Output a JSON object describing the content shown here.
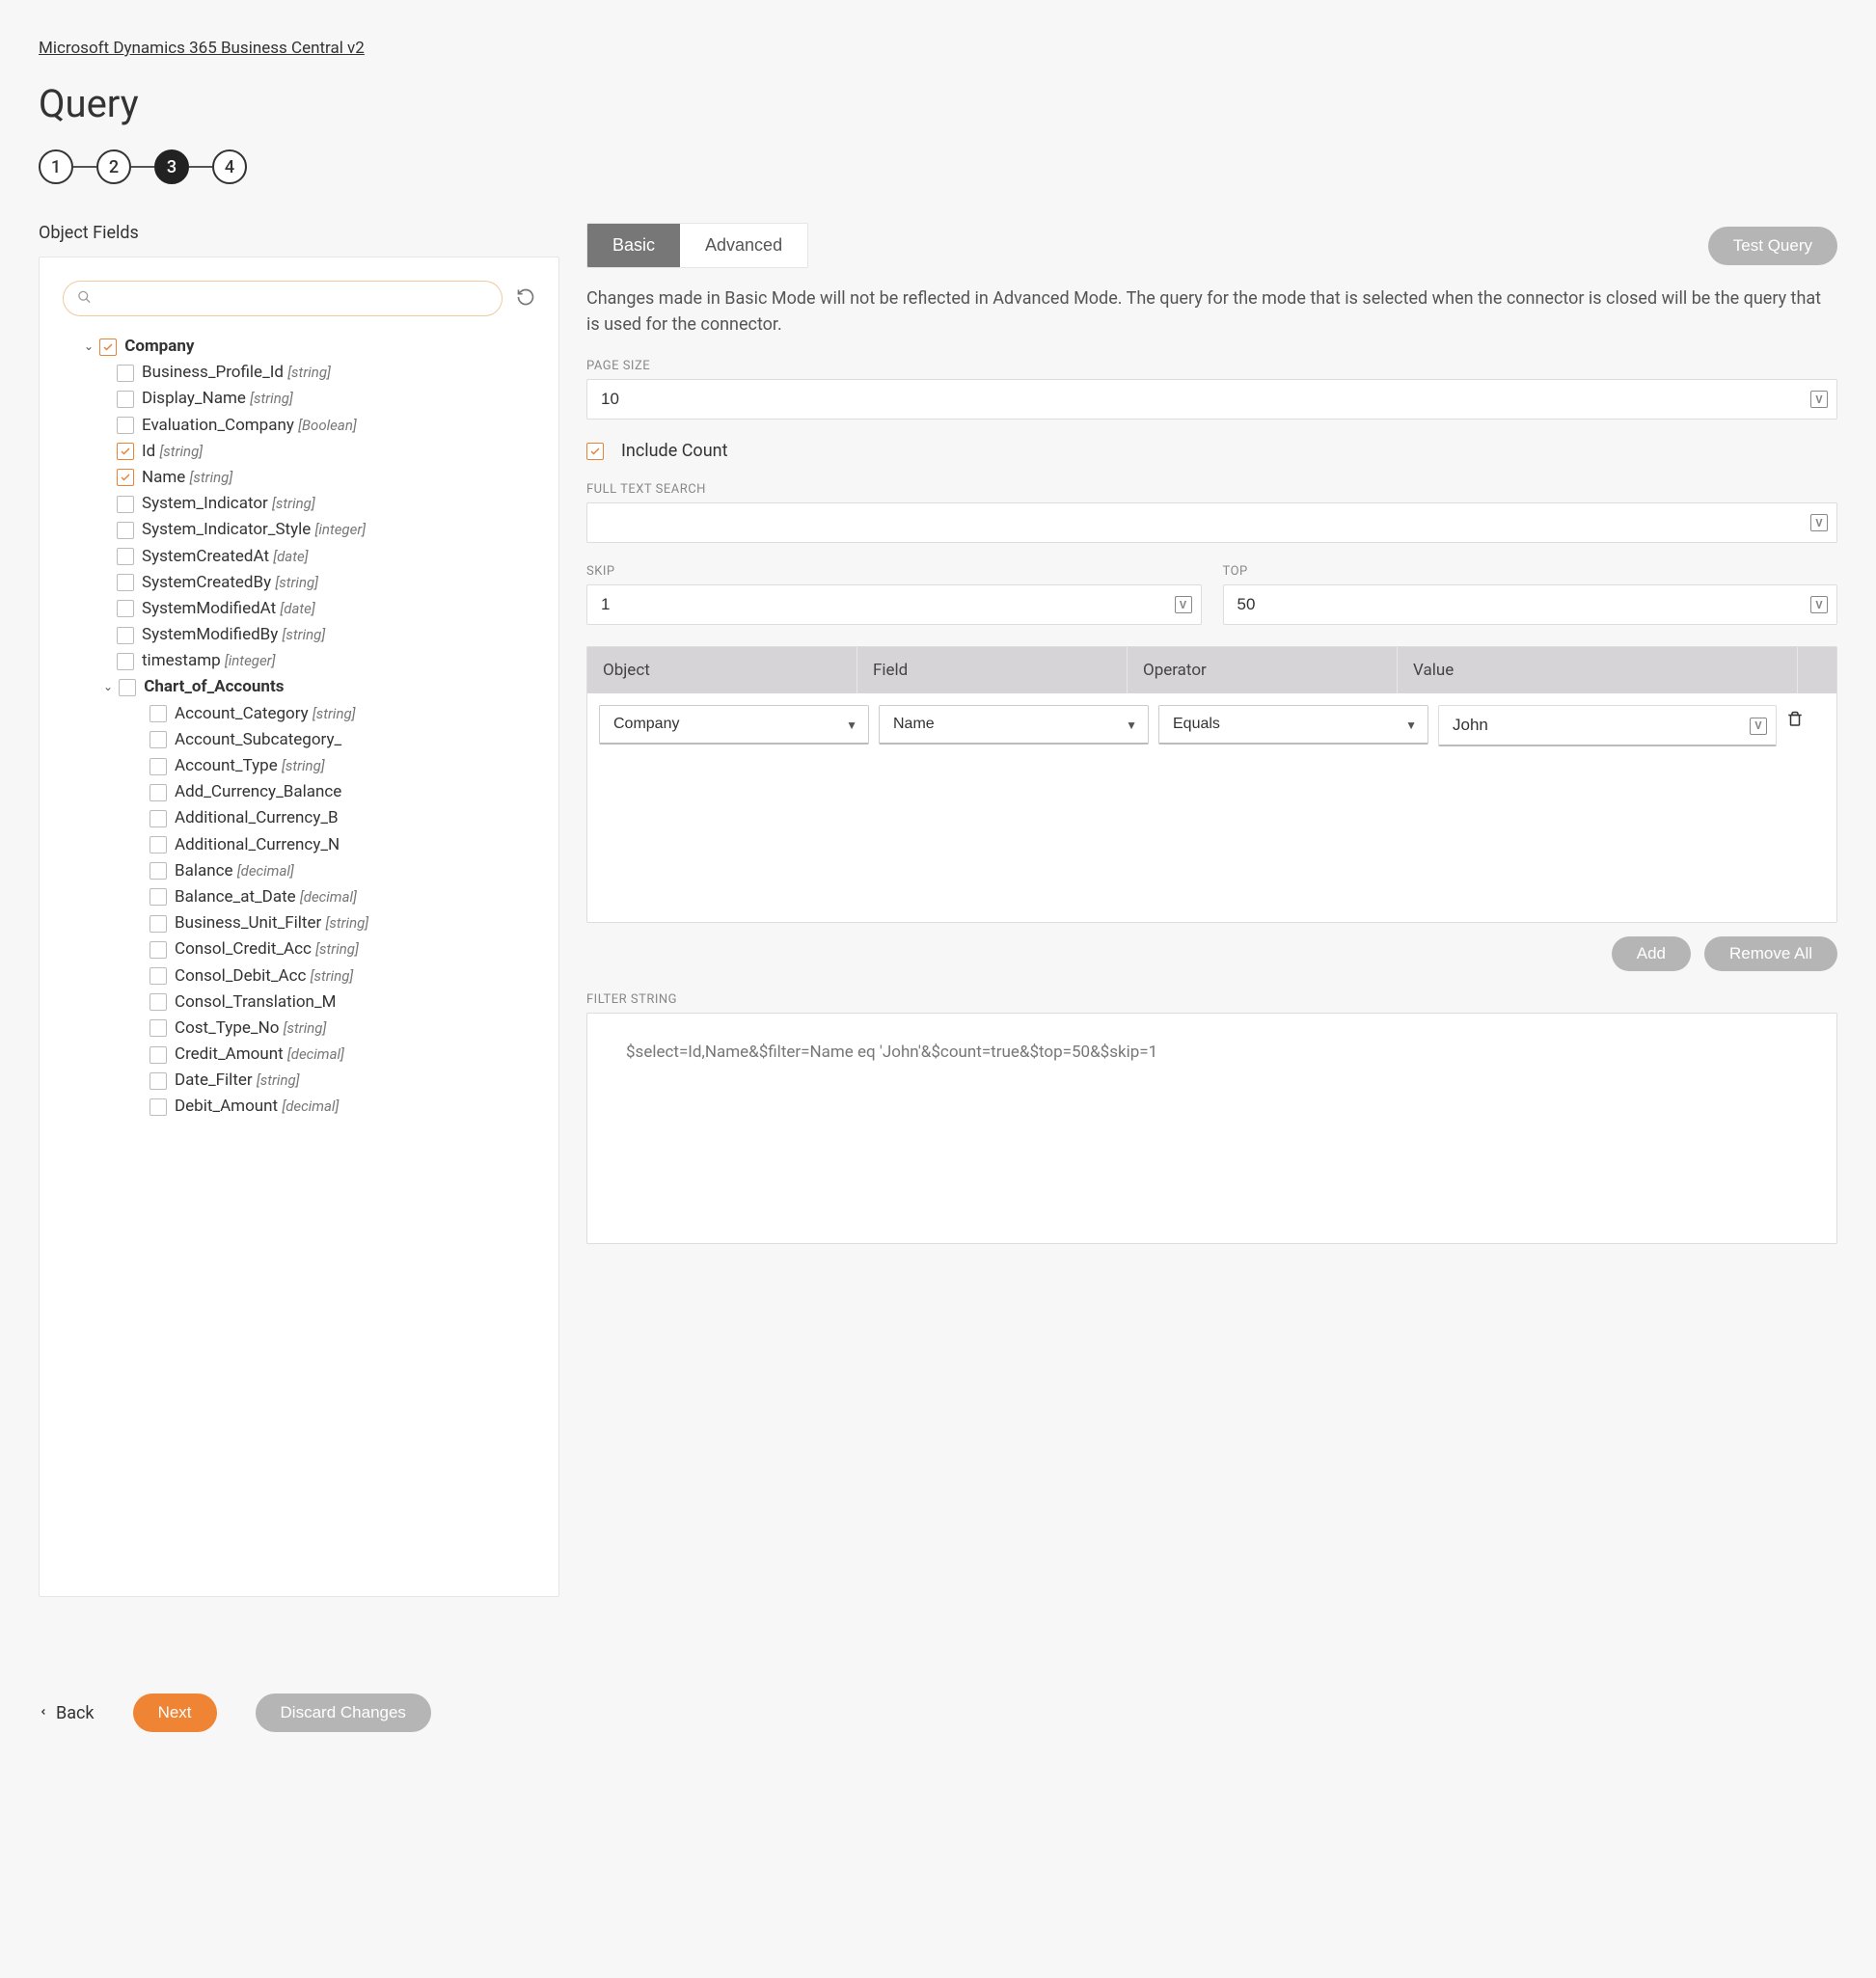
{
  "breadcrumb": "Microsoft Dynamics 365 Business Central v2",
  "page_title": "Query",
  "stepper": {
    "steps": [
      "1",
      "2",
      "3",
      "4"
    ],
    "active": 2
  },
  "left": {
    "title": "Object Fields",
    "search_placeholder": "",
    "tree": {
      "root": {
        "label": "Company",
        "checked": true
      },
      "company_fields": [
        {
          "label": "Business_Profile_Id",
          "type": "[string]",
          "checked": false
        },
        {
          "label": "Display_Name",
          "type": "[string]",
          "checked": false
        },
        {
          "label": "Evaluation_Company",
          "type": "[Boolean]",
          "checked": false
        },
        {
          "label": "Id",
          "type": "[string]",
          "checked": true
        },
        {
          "label": "Name",
          "type": "[string]",
          "checked": true
        },
        {
          "label": "System_Indicator",
          "type": "[string]",
          "checked": false
        },
        {
          "label": "System_Indicator_Style",
          "type": "[integer]",
          "checked": false
        },
        {
          "label": "SystemCreatedAt",
          "type": "[date]",
          "checked": false
        },
        {
          "label": "SystemCreatedBy",
          "type": "[string]",
          "checked": false
        },
        {
          "label": "SystemModifiedAt",
          "type": "[date]",
          "checked": false
        },
        {
          "label": "SystemModifiedBy",
          "type": "[string]",
          "checked": false
        },
        {
          "label": "timestamp",
          "type": "[integer]",
          "checked": false
        }
      ],
      "child": {
        "label": "Chart_of_Accounts",
        "checked": false
      },
      "child_fields": [
        {
          "label": "Account_Category",
          "type": "[string]",
          "checked": false
        },
        {
          "label": "Account_Subcategory_",
          "type": "",
          "checked": false
        },
        {
          "label": "Account_Type",
          "type": "[string]",
          "checked": false
        },
        {
          "label": "Add_Currency_Balance",
          "type": "",
          "checked": false
        },
        {
          "label": "Additional_Currency_B",
          "type": "",
          "checked": false
        },
        {
          "label": "Additional_Currency_N",
          "type": "",
          "checked": false
        },
        {
          "label": "Balance",
          "type": "[decimal]",
          "checked": false
        },
        {
          "label": "Balance_at_Date",
          "type": "[decimal]",
          "checked": false
        },
        {
          "label": "Business_Unit_Filter",
          "type": "[string]",
          "checked": false
        },
        {
          "label": "Consol_Credit_Acc",
          "type": "[string]",
          "checked": false
        },
        {
          "label": "Consol_Debit_Acc",
          "type": "[string]",
          "checked": false
        },
        {
          "label": "Consol_Translation_M",
          "type": "",
          "checked": false
        },
        {
          "label": "Cost_Type_No",
          "type": "[string]",
          "checked": false
        },
        {
          "label": "Credit_Amount",
          "type": "[decimal]",
          "checked": false
        },
        {
          "label": "Date_Filter",
          "type": "[string]",
          "checked": false
        },
        {
          "label": "Debit_Amount",
          "type": "[decimal]",
          "checked": false
        }
      ]
    }
  },
  "right": {
    "tabs": {
      "basic": "Basic",
      "advanced": "Advanced"
    },
    "test_query": "Test Query",
    "info": "Changes made in Basic Mode will not be reflected in Advanced Mode. The query for the mode that is selected when the connector is closed will be the query that is used for the connector.",
    "page_size_label": "PAGE SIZE",
    "page_size": "10",
    "include_count_label": "Include Count",
    "include_count": true,
    "full_text_label": "FULL TEXT SEARCH",
    "full_text": "",
    "skip_label": "SKIP",
    "skip": "1",
    "top_label": "TOP",
    "top": "50",
    "filter_headers": {
      "object": "Object",
      "field": "Field",
      "operator": "Operator",
      "value": "Value"
    },
    "filter_row": {
      "object": "Company",
      "field": "Name",
      "operator": "Equals",
      "value": "John"
    },
    "add_label": "Add",
    "remove_all_label": "Remove All",
    "filter_string_label": "FILTER STRING",
    "filter_string": "$select=Id,Name&$filter=Name eq 'John'&$count=true&$top=50&$skip=1"
  },
  "footer": {
    "back": "Back",
    "next": "Next",
    "discard": "Discard Changes"
  }
}
